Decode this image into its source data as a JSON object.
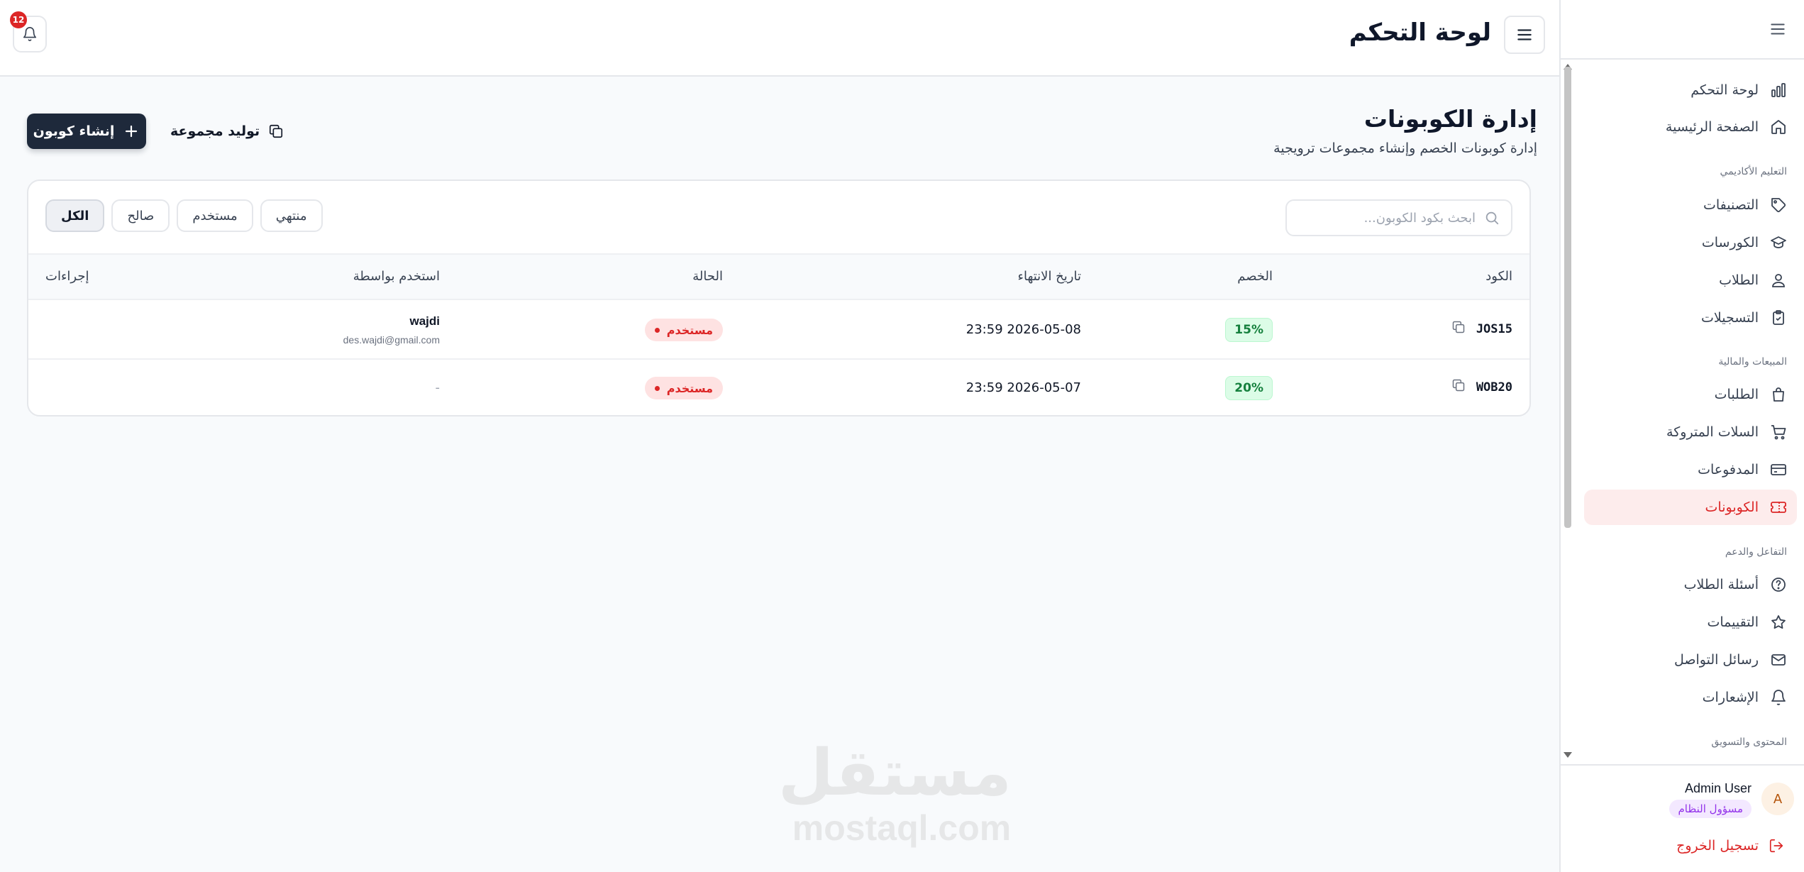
{
  "header": {
    "title": "لوحة التحكم",
    "notifications_count": "12"
  },
  "sidebar": {
    "items": [
      {
        "label": "لوحة التحكم",
        "icon": "bar-chart-icon"
      },
      {
        "label": "الصفحة الرئيسية",
        "icon": "home-icon"
      },
      {
        "label": "التصنيفات",
        "icon": "tag-icon"
      },
      {
        "label": "الكورسات",
        "icon": "graduation-cap-icon"
      },
      {
        "label": "الطلاب",
        "icon": "student-icon"
      },
      {
        "label": "التسجيلات",
        "icon": "clipboard-check-icon"
      },
      {
        "label": "الطلبات",
        "icon": "shopping-bag-icon"
      },
      {
        "label": "السلات المتروكة",
        "icon": "shopping-cart-icon"
      },
      {
        "label": "المدفوعات",
        "icon": "credit-card-icon"
      },
      {
        "label": "الكوبونات",
        "icon": "ticket-icon"
      },
      {
        "label": "أسئلة الطلاب",
        "icon": "question-circle-icon"
      },
      {
        "label": "التقييمات",
        "icon": "star-icon"
      },
      {
        "label": "رسائل التواصل",
        "icon": "mail-icon"
      },
      {
        "label": "الإشعارات",
        "icon": "bell-icon"
      }
    ],
    "active_item": "الكوبونات",
    "sections": {
      "academic": "التعليم الأكاديمي",
      "sales": "المبيعات والمالية",
      "engagement": "التفاعل والدعم",
      "content": "المحتوى والتسويق"
    },
    "user": {
      "avatar_letter": "A",
      "name": "Admin User",
      "role": "مسؤول النظام"
    },
    "logout_label": "تسجيل الخروج"
  },
  "main": {
    "title": "إدارة الكوبونات",
    "subtitle": "إدارة كوبونات الخصم وإنشاء مجموعات ترويجية",
    "create_button": "إنشاء كوبون",
    "generate_button": "توليد مجموعة",
    "search_placeholder": "ابحث بكود الكوبون...",
    "filters": [
      "الكل",
      "صالح",
      "مستخدم",
      "منتهي"
    ],
    "active_filter": "الكل",
    "columns": {
      "code": "الكود",
      "discount": "الخصم",
      "expiry": "تاريخ الانتهاء",
      "status": "الحالة",
      "used_by": "استخدم بواسطة",
      "actions": "إجراءات"
    },
    "rows": [
      {
        "code": "JOS15",
        "discount": "15%",
        "expiry": "2026-05-08 23:59",
        "status": "مستخدم",
        "used_by_name": "wajdi",
        "used_by_email": "des.wajdi@gmail.com"
      },
      {
        "code": "WOB20",
        "discount": "20%",
        "expiry": "2026-05-07 23:59",
        "status": "مستخدم",
        "used_by_name": "-",
        "used_by_email": ""
      }
    ]
  },
  "watermark": {
    "arabic": "مستقل",
    "latin": "mostaql.com"
  },
  "colors": {
    "primary_dark": "#1e293b",
    "accent_red": "#dc2626",
    "success_green": "#15803d",
    "active_bg": "#fdecec"
  }
}
